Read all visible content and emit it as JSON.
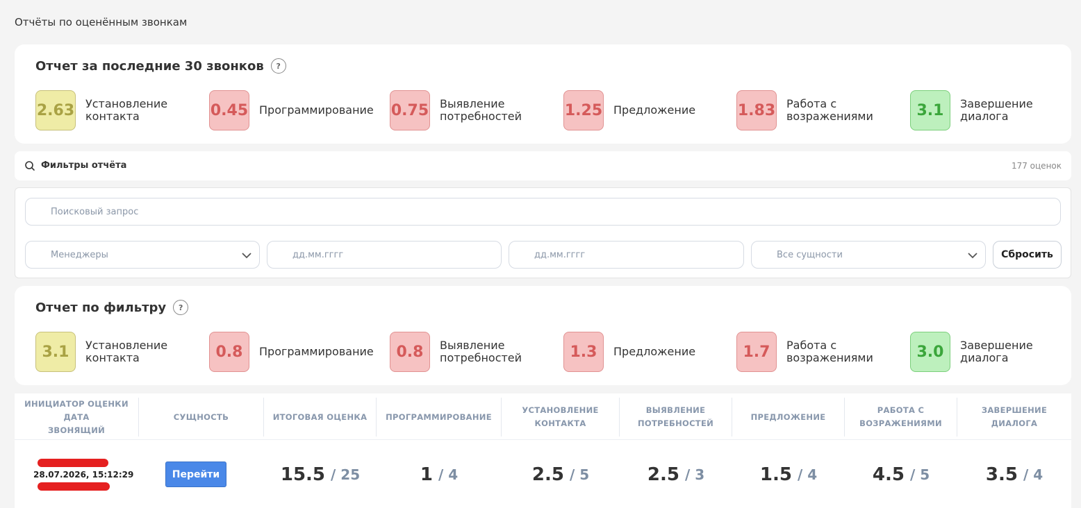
{
  "page": {
    "title": "Отчёты по оценённым звонкам"
  },
  "report_last": {
    "title": "Отчет за последние 30 звонков",
    "help": "?",
    "metrics": [
      {
        "value": "2.63",
        "label": "Установление контакта",
        "color": "yellow"
      },
      {
        "value": "0.45",
        "label": "Программирование",
        "color": "red"
      },
      {
        "value": "0.75",
        "label": "Выявление потребностей",
        "color": "red"
      },
      {
        "value": "1.25",
        "label": "Предложение",
        "color": "red"
      },
      {
        "value": "1.83",
        "label": "Работа с возражениями",
        "color": "red"
      },
      {
        "value": "3.1",
        "label": "Завершение диалога",
        "color": "green"
      }
    ]
  },
  "filters": {
    "label": "Фильтры отчёта",
    "count": "177 оценок",
    "search_placeholder": "Поисковый запрос",
    "managers_placeholder": "Менеджеры",
    "date_from_placeholder": "дд.мм.гггг",
    "date_to_placeholder": "дд.мм.гггг",
    "entities_placeholder": "Все сущности",
    "reset_label": "Сбросить"
  },
  "report_filter": {
    "title": "Отчет по фильтру",
    "help": "?",
    "metrics": [
      {
        "value": "3.1",
        "label": "Установление контакта",
        "color": "yellow"
      },
      {
        "value": "0.8",
        "label": "Программирование",
        "color": "red"
      },
      {
        "value": "0.8",
        "label": "Выявление потребностей",
        "color": "red"
      },
      {
        "value": "1.3",
        "label": "Предложение",
        "color": "red"
      },
      {
        "value": "1.7",
        "label": "Работа с возражениями",
        "color": "red"
      },
      {
        "value": "3.0",
        "label": "Завершение диалога",
        "color": "green"
      }
    ]
  },
  "table": {
    "headers": [
      "ИНИЦИАТОР ОЦЕНКИ\nДАТА\nЗВОНЯЩИЙ",
      "СУЩНОСТЬ",
      "ИТОГОВАЯ ОЦЕНКА",
      "ПРОГРАММИРОВАНИЕ",
      "УСТАНОВЛЕНИЕ\nКОНТАКТА",
      "ВЫЯВЛЕНИЕ\nПОТРЕБНОСТЕЙ",
      "ПРЕДЛОЖЕНИЕ",
      "РАБОТА С\nВОЗРАЖЕНИЯМИ",
      "ЗАВЕРШЕНИЕ\nДИАЛОГА"
    ],
    "row": {
      "datetime": "28.07.2026, 15:12:29",
      "go_label": "Перейти",
      "scores": [
        {
          "value": "15.5",
          "max": "/ 25"
        },
        {
          "value": "1",
          "max": "/ 4"
        },
        {
          "value": "2.5",
          "max": "/ 5"
        },
        {
          "value": "2.5",
          "max": "/ 3"
        },
        {
          "value": "1.5",
          "max": "/ 4"
        },
        {
          "value": "4.5",
          "max": "/ 5"
        },
        {
          "value": "3.5",
          "max": "/ 4"
        }
      ]
    }
  }
}
